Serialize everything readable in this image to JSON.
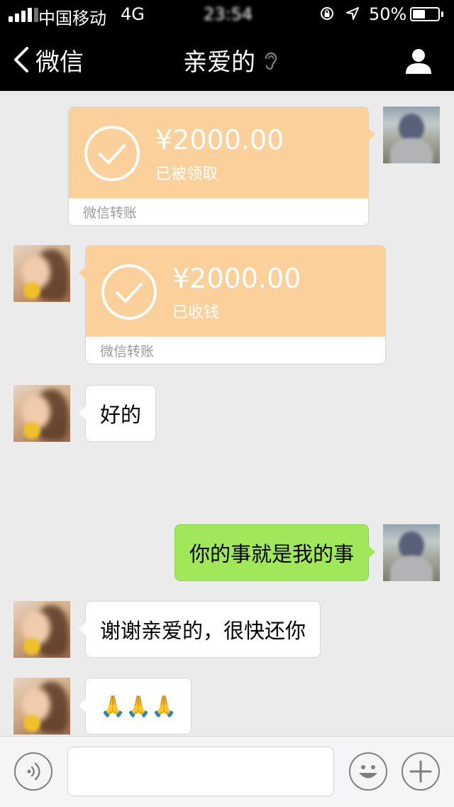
{
  "status_bar": {
    "carrier": "中国移动",
    "network": "4G",
    "time": "23:54",
    "battery": "50%",
    "battery_level": 0.5
  },
  "nav": {
    "back_label": "微信",
    "title": "亲爱的"
  },
  "messages": [
    {
      "type": "transfer",
      "side": "right",
      "amount": "¥2000.00",
      "status": "已被领取",
      "footer": "微信转账"
    },
    {
      "type": "transfer",
      "side": "left",
      "amount": "¥2000.00",
      "status": "已收钱",
      "footer": "微信转账"
    },
    {
      "type": "text",
      "side": "left",
      "text": "好的"
    },
    {
      "type": "text",
      "side": "right",
      "text": "你的事就是我的事"
    },
    {
      "type": "text",
      "side": "left",
      "text": "谢谢亲爱的，很快还你"
    },
    {
      "type": "text",
      "side": "left",
      "text": "🙏🙏🙏"
    }
  ],
  "colors": {
    "transfer_orange": "#fcd09a",
    "my_bubble_green": "#a0e75a",
    "background": "#ebebeb"
  }
}
